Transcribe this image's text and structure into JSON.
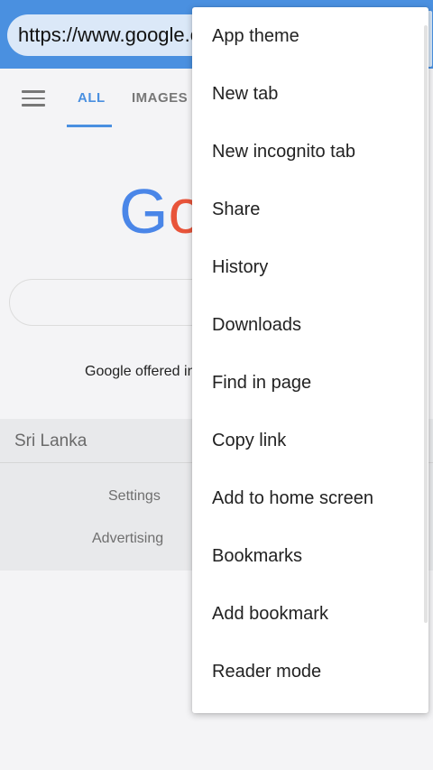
{
  "url_bar": {
    "url": "https://www.google.com/"
  },
  "google_page": {
    "tabs": [
      {
        "label": "ALL"
      },
      {
        "label": "IMAGES"
      }
    ],
    "logo_text": "Google",
    "offered_text": "Google offered in:",
    "footer": {
      "country": "Sri Lanka",
      "settings_label": "Settings",
      "advertising_label": "Advertising"
    }
  },
  "menu": {
    "items": [
      {
        "label": "App theme"
      },
      {
        "label": "New tab"
      },
      {
        "label": "New incognito tab"
      },
      {
        "label": "Share"
      },
      {
        "label": "History"
      },
      {
        "label": "Downloads"
      },
      {
        "label": "Find in page"
      },
      {
        "label": "Copy link"
      },
      {
        "label": "Add to home screen"
      },
      {
        "label": "Bookmarks"
      },
      {
        "label": "Add bookmark"
      },
      {
        "label": "Reader mode"
      }
    ]
  },
  "colors": {
    "toolbar": "#4a90e0",
    "accent": "#4a90e0"
  }
}
